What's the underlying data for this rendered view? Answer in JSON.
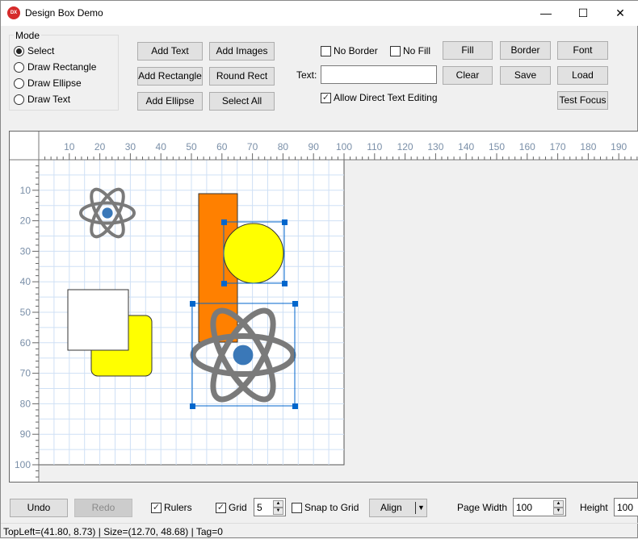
{
  "window": {
    "title": "Design Box Demo",
    "icon_text": "DX",
    "controls": [
      "minimize",
      "maximize",
      "close"
    ]
  },
  "mode": {
    "label": "Mode",
    "options": [
      {
        "label": "Select",
        "selected": true
      },
      {
        "label": "Draw Rectangle",
        "selected": false
      },
      {
        "label": "Draw Ellipse",
        "selected": false
      },
      {
        "label": "Draw Text",
        "selected": false
      }
    ]
  },
  "buttons": {
    "add_text": "Add Text",
    "add_images": "Add Images",
    "add_rectangle": "Add Rectangle",
    "round_rect": "Round Rect",
    "add_ellipse": "Add Ellipse",
    "select_all": "Select All",
    "fill": "Fill",
    "border": "Border",
    "font": "Font",
    "clear": "Clear",
    "save": "Save",
    "load": "Load",
    "test_focus": "Test Focus",
    "undo": "Undo",
    "redo": "Redo",
    "align": "Align"
  },
  "options": {
    "no_border": {
      "label": "No Border",
      "checked": false
    },
    "no_fill": {
      "label": "No Fill",
      "checked": false
    },
    "allow_direct_text": {
      "label": "Allow Direct Text Editing",
      "checked": true
    },
    "rulers": {
      "label": "Rulers",
      "checked": true
    },
    "grid": {
      "label": "Grid",
      "checked": true
    },
    "snap": {
      "label": "Snap to Grid",
      "checked": false
    }
  },
  "text_field": {
    "label": "Text:",
    "value": ""
  },
  "grid_size": "5",
  "page_width": {
    "label": "Page Width",
    "value": "100"
  },
  "page_height": {
    "label": "Height",
    "value": "100"
  },
  "ruler": {
    "h_labels": [
      "10",
      "20",
      "30",
      "40",
      "50",
      "60",
      "70",
      "80",
      "90",
      "100",
      "110",
      "120",
      "130",
      "140",
      "150",
      "160",
      "170",
      "180",
      "190"
    ],
    "v_labels": [
      "10",
      "20",
      "30",
      "40",
      "50",
      "60",
      "70",
      "80",
      "90",
      "100"
    ]
  },
  "colors": {
    "orange": "#ff8000",
    "yellow": "#ffff00",
    "selection": "#0066cc",
    "grid": "#cfe0f5",
    "atom_gray": "#7a7a7a",
    "atom_blue": "#3a78b8",
    "ruler_text": "#7a8fa8"
  },
  "status": "TopLeft=(41.80, 8.73) | Size=(12.70, 48.68) | Tag=0"
}
